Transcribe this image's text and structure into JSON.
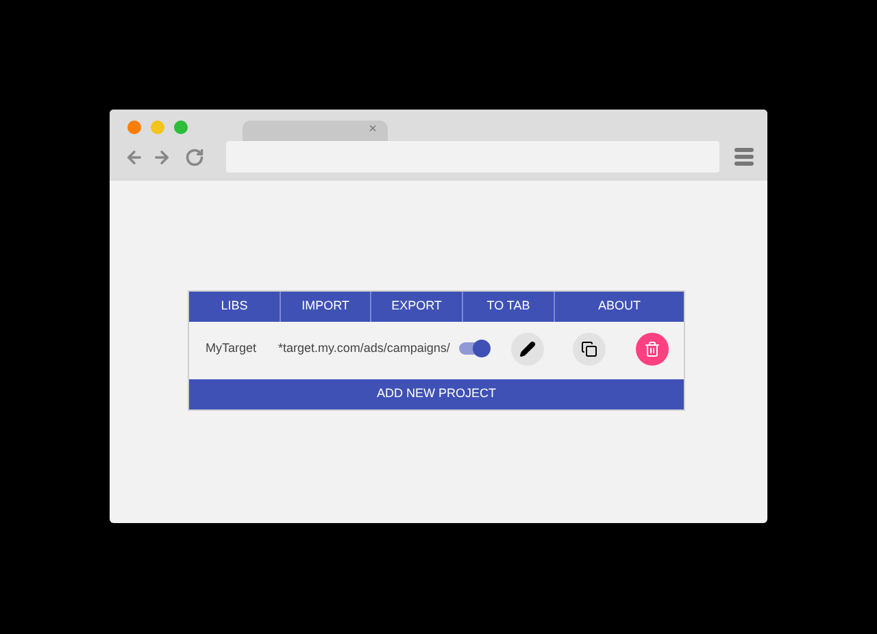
{
  "browser": {
    "tab": {
      "close": "×"
    }
  },
  "menu": [
    {
      "label": "LIBS"
    },
    {
      "label": "IMPORT"
    },
    {
      "label": "EXPORT"
    },
    {
      "label": "TO TAB"
    },
    {
      "label": "ABOUT"
    }
  ],
  "projects": [
    {
      "name": "MyTarget",
      "pattern": "*target.my.com/ads/campaigns/",
      "on": true
    }
  ],
  "add_button": "ADD NEW PROJECT"
}
